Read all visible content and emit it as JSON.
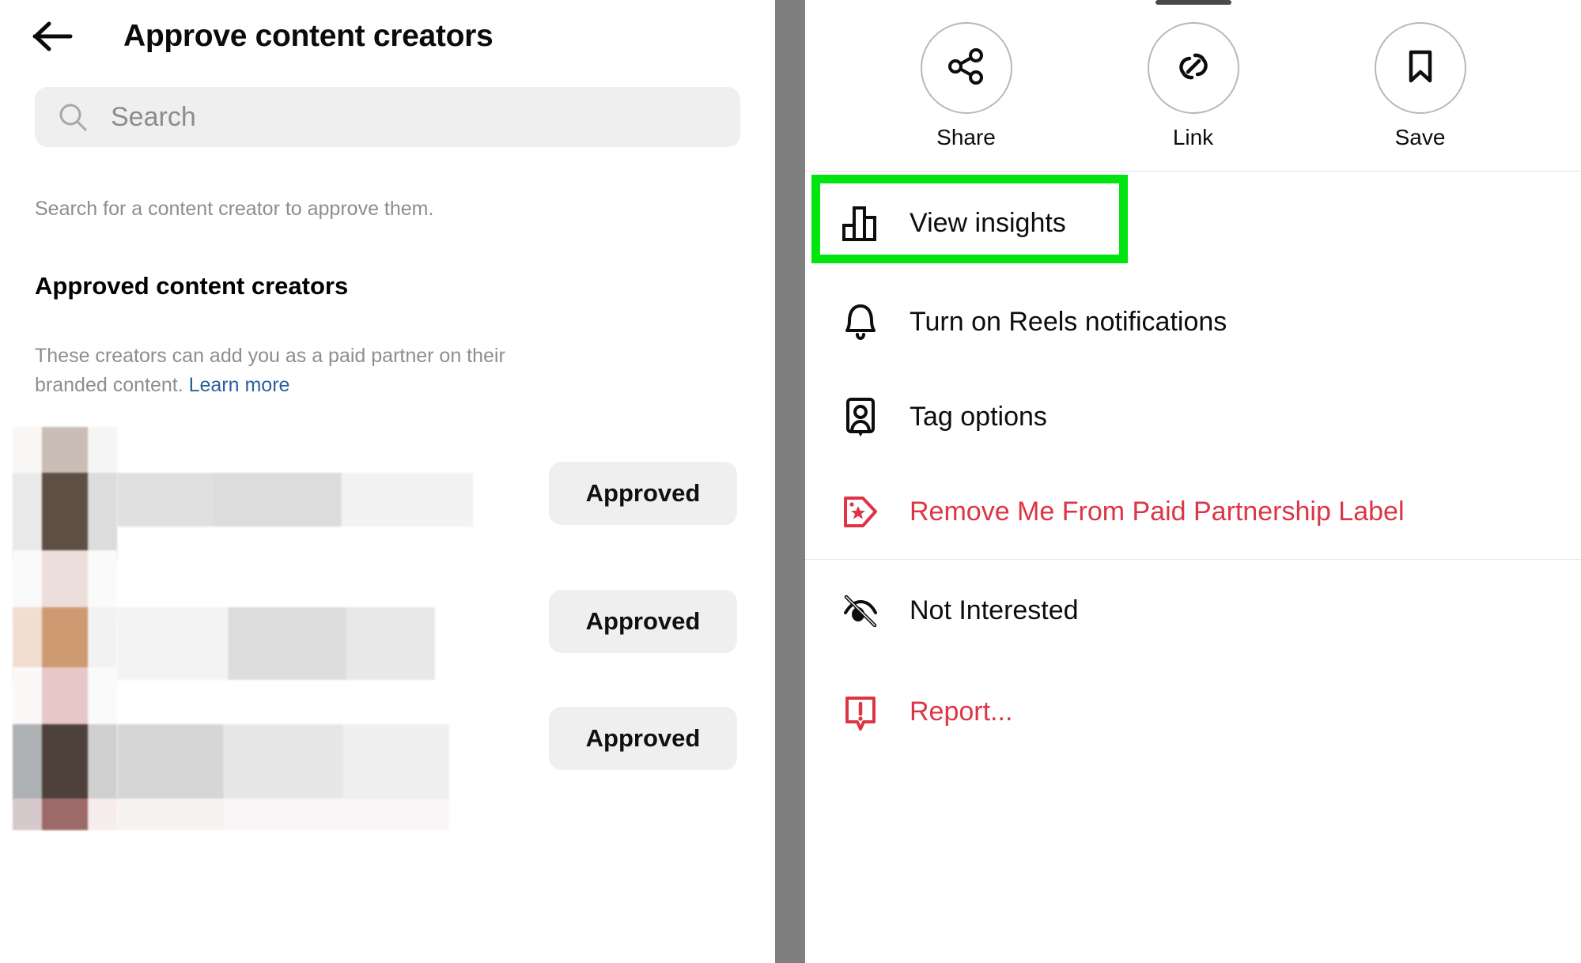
{
  "left": {
    "back_icon": "arrow-left-icon",
    "title": "Approve content creators",
    "search": {
      "icon": "search-icon",
      "placeholder": "Search",
      "value": ""
    },
    "helper_text": "Search for a content creator to approve them.",
    "section_title": "Approved content creators",
    "section_desc": "These creators can add you as a paid partner on their branded content. ",
    "learn_more": "Learn more",
    "creators": [
      {
        "name_redacted": true,
        "button_label": "Approved"
      },
      {
        "name_redacted": true,
        "button_label": "Approved"
      },
      {
        "name_redacted": true,
        "button_label": "Approved"
      }
    ]
  },
  "right": {
    "handle": "drag-handle",
    "actions": [
      {
        "icon": "share-icon",
        "label": "Share"
      },
      {
        "icon": "link-icon",
        "label": "Link"
      },
      {
        "icon": "bookmark-icon",
        "label": "Save"
      }
    ],
    "menu": [
      {
        "icon": "bar-chart-icon",
        "label": "View insights",
        "danger": false,
        "highlighted": true
      },
      {
        "icon": "bell-icon",
        "label": "Turn on Reels notifications",
        "danger": false,
        "highlighted": false
      },
      {
        "icon": "tag-person-icon",
        "label": "Tag options",
        "danger": false,
        "highlighted": false
      },
      {
        "icon": "price-tag-star-icon",
        "label": "Remove Me From Paid Partnership Label",
        "danger": true,
        "highlighted": false
      },
      {
        "icon": "eye-off-icon",
        "label": "Not Interested",
        "danger": false,
        "highlighted": false
      },
      {
        "icon": "report-icon",
        "label": "Report...",
        "danger": true,
        "highlighted": false
      }
    ]
  },
  "colors": {
    "highlight_green": "#00e510",
    "danger_red": "#dc3545",
    "link_blue": "#2b5f9e",
    "divider_gray": "#7f7f7f",
    "field_gray": "#efefef",
    "muted_text": "#8e8e8e"
  }
}
